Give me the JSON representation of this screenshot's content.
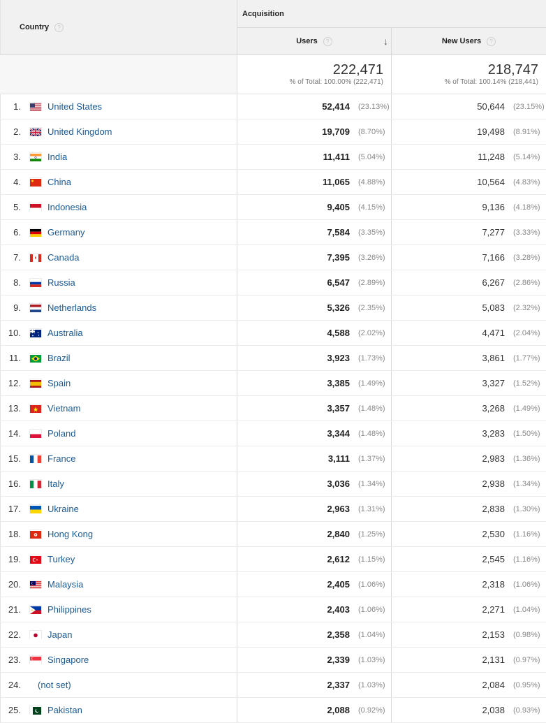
{
  "header": {
    "country_label": "Country",
    "acquisition_label": "Acquisition",
    "users_label": "Users",
    "new_users_label": "New Users",
    "help_glyph": "?",
    "sort_icon": "↓"
  },
  "totals": {
    "users": "222,471",
    "users_sub": "% of Total: 100.00% (222,471)",
    "new_users": "218,747",
    "new_users_sub": "% of Total: 100.14% (218,441)"
  },
  "rows": [
    {
      "rank": "1.",
      "country": "United States",
      "flag": "us",
      "users": "52,414",
      "users_pct": "(23.13%)",
      "new_users": "50,644",
      "new_pct": "(23.15%)"
    },
    {
      "rank": "2.",
      "country": "United Kingdom",
      "flag": "gb",
      "users": "19,709",
      "users_pct": "(8.70%)",
      "new_users": "19,498",
      "new_pct": "(8.91%)"
    },
    {
      "rank": "3.",
      "country": "India",
      "flag": "in",
      "users": "11,411",
      "users_pct": "(5.04%)",
      "new_users": "11,248",
      "new_pct": "(5.14%)"
    },
    {
      "rank": "4.",
      "country": "China",
      "flag": "cn",
      "users": "11,065",
      "users_pct": "(4.88%)",
      "new_users": "10,564",
      "new_pct": "(4.83%)"
    },
    {
      "rank": "5.",
      "country": "Indonesia",
      "flag": "id",
      "users": "9,405",
      "users_pct": "(4.15%)",
      "new_users": "9,136",
      "new_pct": "(4.18%)"
    },
    {
      "rank": "6.",
      "country": "Germany",
      "flag": "de",
      "users": "7,584",
      "users_pct": "(3.35%)",
      "new_users": "7,277",
      "new_pct": "(3.33%)"
    },
    {
      "rank": "7.",
      "country": "Canada",
      "flag": "ca",
      "users": "7,395",
      "users_pct": "(3.26%)",
      "new_users": "7,166",
      "new_pct": "(3.28%)"
    },
    {
      "rank": "8.",
      "country": "Russia",
      "flag": "ru",
      "users": "6,547",
      "users_pct": "(2.89%)",
      "new_users": "6,267",
      "new_pct": "(2.86%)"
    },
    {
      "rank": "9.",
      "country": "Netherlands",
      "flag": "nl",
      "users": "5,326",
      "users_pct": "(2.35%)",
      "new_users": "5,083",
      "new_pct": "(2.32%)"
    },
    {
      "rank": "10.",
      "country": "Australia",
      "flag": "au",
      "users": "4,588",
      "users_pct": "(2.02%)",
      "new_users": "4,471",
      "new_pct": "(2.04%)"
    },
    {
      "rank": "11.",
      "country": "Brazil",
      "flag": "br",
      "users": "3,923",
      "users_pct": "(1.73%)",
      "new_users": "3,861",
      "new_pct": "(1.77%)"
    },
    {
      "rank": "12.",
      "country": "Spain",
      "flag": "es",
      "users": "3,385",
      "users_pct": "(1.49%)",
      "new_users": "3,327",
      "new_pct": "(1.52%)"
    },
    {
      "rank": "13.",
      "country": "Vietnam",
      "flag": "vn",
      "users": "3,357",
      "users_pct": "(1.48%)",
      "new_users": "3,268",
      "new_pct": "(1.49%)"
    },
    {
      "rank": "14.",
      "country": "Poland",
      "flag": "pl",
      "users": "3,344",
      "users_pct": "(1.48%)",
      "new_users": "3,283",
      "new_pct": "(1.50%)"
    },
    {
      "rank": "15.",
      "country": "France",
      "flag": "fr",
      "users": "3,111",
      "users_pct": "(1.37%)",
      "new_users": "2,983",
      "new_pct": "(1.36%)"
    },
    {
      "rank": "16.",
      "country": "Italy",
      "flag": "it",
      "users": "3,036",
      "users_pct": "(1.34%)",
      "new_users": "2,938",
      "new_pct": "(1.34%)"
    },
    {
      "rank": "17.",
      "country": "Ukraine",
      "flag": "ua",
      "users": "2,963",
      "users_pct": "(1.31%)",
      "new_users": "2,838",
      "new_pct": "(1.30%)"
    },
    {
      "rank": "18.",
      "country": "Hong Kong",
      "flag": "hk",
      "users": "2,840",
      "users_pct": "(1.25%)",
      "new_users": "2,530",
      "new_pct": "(1.16%)"
    },
    {
      "rank": "19.",
      "country": "Turkey",
      "flag": "tr",
      "users": "2,612",
      "users_pct": "(1.15%)",
      "new_users": "2,545",
      "new_pct": "(1.16%)"
    },
    {
      "rank": "20.",
      "country": "Malaysia",
      "flag": "my",
      "users": "2,405",
      "users_pct": "(1.06%)",
      "new_users": "2,318",
      "new_pct": "(1.06%)"
    },
    {
      "rank": "21.",
      "country": "Philippines",
      "flag": "ph",
      "users": "2,403",
      "users_pct": "(1.06%)",
      "new_users": "2,271",
      "new_pct": "(1.04%)"
    },
    {
      "rank": "22.",
      "country": "Japan",
      "flag": "jp",
      "users": "2,358",
      "users_pct": "(1.04%)",
      "new_users": "2,153",
      "new_pct": "(0.98%)"
    },
    {
      "rank": "23.",
      "country": "Singapore",
      "flag": "sg",
      "users": "2,339",
      "users_pct": "(1.03%)",
      "new_users": "2,131",
      "new_pct": "(0.97%)"
    },
    {
      "rank": "24.",
      "country": "(not set)",
      "flag": "",
      "users": "2,337",
      "users_pct": "(1.03%)",
      "new_users": "2,084",
      "new_pct": "(0.95%)"
    },
    {
      "rank": "25.",
      "country": "Pakistan",
      "flag": "pk",
      "users": "2,088",
      "users_pct": "(0.92%)",
      "new_users": "2,038",
      "new_pct": "(0.93%)"
    }
  ]
}
